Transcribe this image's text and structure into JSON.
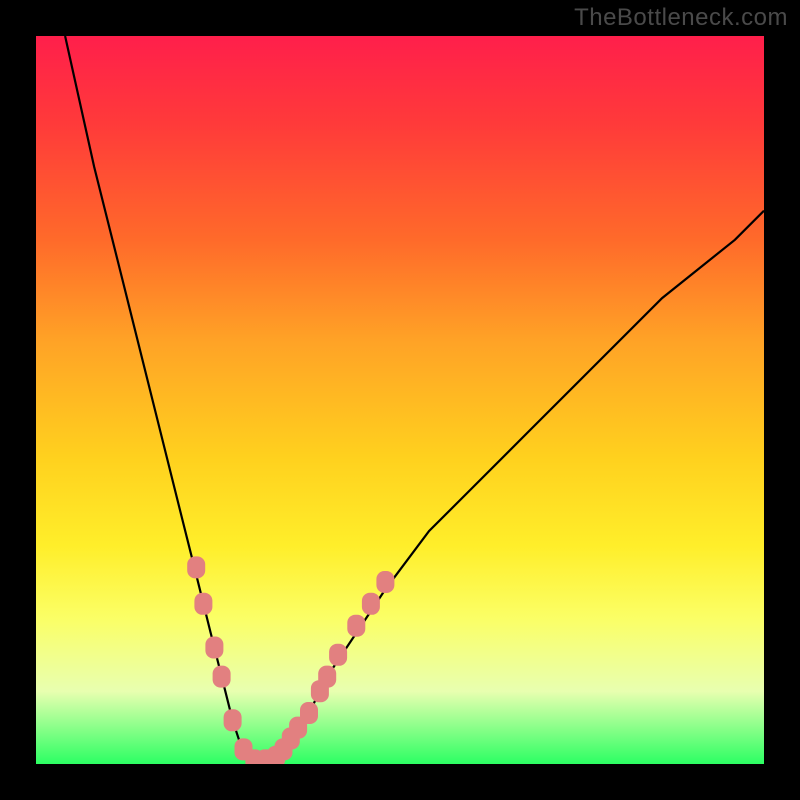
{
  "watermark": "TheBottleneck.com",
  "chart_data": {
    "type": "line",
    "title": "",
    "xlabel": "",
    "ylabel": "",
    "xlim": [
      0,
      100
    ],
    "ylim": [
      0,
      100
    ],
    "series": [
      {
        "name": "curve",
        "x": [
          4,
          8,
          12,
          16,
          20,
          22,
          24,
          26,
          27,
          28,
          29,
          30,
          31,
          32,
          33,
          34,
          36,
          38,
          40,
          44,
          48,
          54,
          60,
          68,
          76,
          86,
          96,
          100
        ],
        "y": [
          100,
          82,
          66,
          50,
          34,
          26,
          18,
          10,
          6,
          3,
          1,
          0,
          0,
          0,
          1,
          2,
          5,
          8,
          12,
          18,
          24,
          32,
          38,
          46,
          54,
          64,
          72,
          76
        ]
      }
    ],
    "markers": [
      {
        "x": 22.0,
        "y": 27.0
      },
      {
        "x": 23.0,
        "y": 22.0
      },
      {
        "x": 24.5,
        "y": 16.0
      },
      {
        "x": 25.5,
        "y": 12.0
      },
      {
        "x": 27.0,
        "y": 6.0
      },
      {
        "x": 28.5,
        "y": 2.0
      },
      {
        "x": 30.0,
        "y": 0.5
      },
      {
        "x": 31.5,
        "y": 0.5
      },
      {
        "x": 33.0,
        "y": 1.0
      },
      {
        "x": 34.0,
        "y": 2.0
      },
      {
        "x": 35.0,
        "y": 3.5
      },
      {
        "x": 36.0,
        "y": 5.0
      },
      {
        "x": 37.5,
        "y": 7.0
      },
      {
        "x": 39.0,
        "y": 10.0
      },
      {
        "x": 40.0,
        "y": 12.0
      },
      {
        "x": 41.5,
        "y": 15.0
      },
      {
        "x": 44.0,
        "y": 19.0
      },
      {
        "x": 46.0,
        "y": 22.0
      },
      {
        "x": 48.0,
        "y": 25.0
      }
    ],
    "marker_color": "#e28080",
    "curve_color": "#000000"
  }
}
